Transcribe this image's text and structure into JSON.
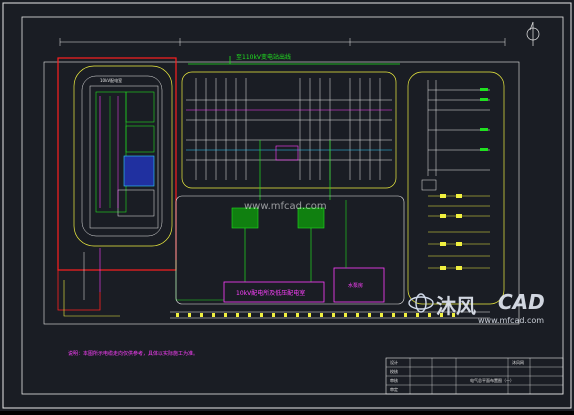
{
  "drawing": {
    "top_feeder_label": "至110kV变电站出线",
    "left_substation_label": "10kV配电室",
    "bus_label": "10kV配电所及低压配电室",
    "right_box_label": "水泵房",
    "note_text": "说明：本图所示电缆走向仅供参考，具体以实际施工为准。",
    "title_block_title": "电气总平面布置图（一）",
    "title_block_logo": "沐风网",
    "title_block_rows": [
      "设计",
      "校核",
      "审核",
      "审定"
    ]
  },
  "watermark": {
    "brand_cn": "沐风",
    "brand_en": "CAD",
    "url": "www.mfcad.com",
    "center_url": "www.mfcad.com"
  },
  "colors": {
    "background": "#1a1d24",
    "red": "#ff2020",
    "yellow": "#f0f040",
    "green": "#20e020",
    "magenta": "#ff40ff",
    "white": "#e8e8e8",
    "cyan": "#30d0ff"
  }
}
